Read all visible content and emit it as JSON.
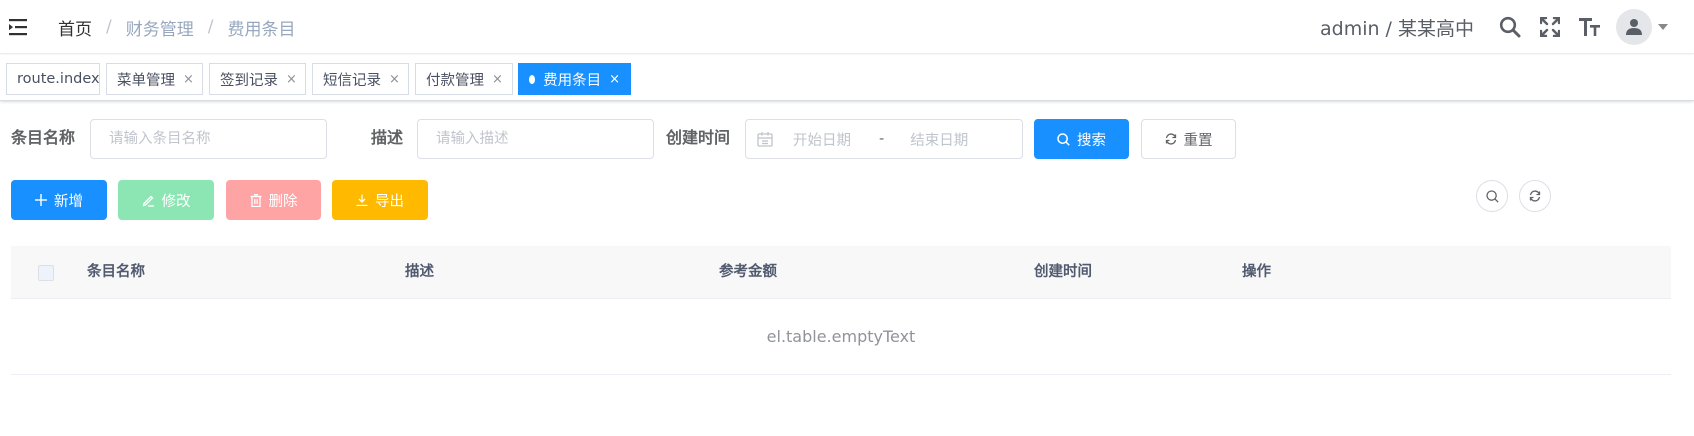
{
  "navbar": {
    "breadcrumb": [
      "首页",
      "财务管理",
      "费用条目"
    ],
    "breadcrumb_sep": "/",
    "user_label": "admin / 某某高中",
    "icons": [
      "hamburger-icon",
      "search-icon",
      "fullscreen-icon",
      "font-size-icon",
      "user-avatar-icon"
    ]
  },
  "tags": [
    {
      "label": "route.index",
      "closable": false,
      "active": false
    },
    {
      "label": "菜单管理",
      "closable": true,
      "active": false
    },
    {
      "label": "签到记录",
      "closable": true,
      "active": false
    },
    {
      "label": "短信记录",
      "closable": true,
      "active": false
    },
    {
      "label": "付款管理",
      "closable": true,
      "active": false
    },
    {
      "label": "费用条目",
      "closable": true,
      "active": true
    }
  ],
  "tag_close_glyph": "×",
  "search_form": {
    "name_label": "条目名称",
    "name_placeholder": "请输入条目名称",
    "desc_label": "描述",
    "desc_placeholder": "请输入描述",
    "time_label": "创建时间",
    "start_placeholder": "开始日期",
    "range_separator": "-",
    "end_placeholder": "结束日期",
    "search_button": "搜索",
    "reset_button": "重置"
  },
  "toolbar": {
    "add": "新增",
    "edit": "修改",
    "delete": "删除",
    "export": "导出"
  },
  "table": {
    "columns": [
      "条目名称",
      "描述",
      "参考金额",
      "创建时间",
      "操作"
    ],
    "empty_text": "el.table.emptyText"
  },
  "colors": {
    "primary": "#1890ff",
    "success_disabled": "#8ce6b3",
    "danger_disabled": "#ffa4a4",
    "warning": "#ffba00"
  }
}
